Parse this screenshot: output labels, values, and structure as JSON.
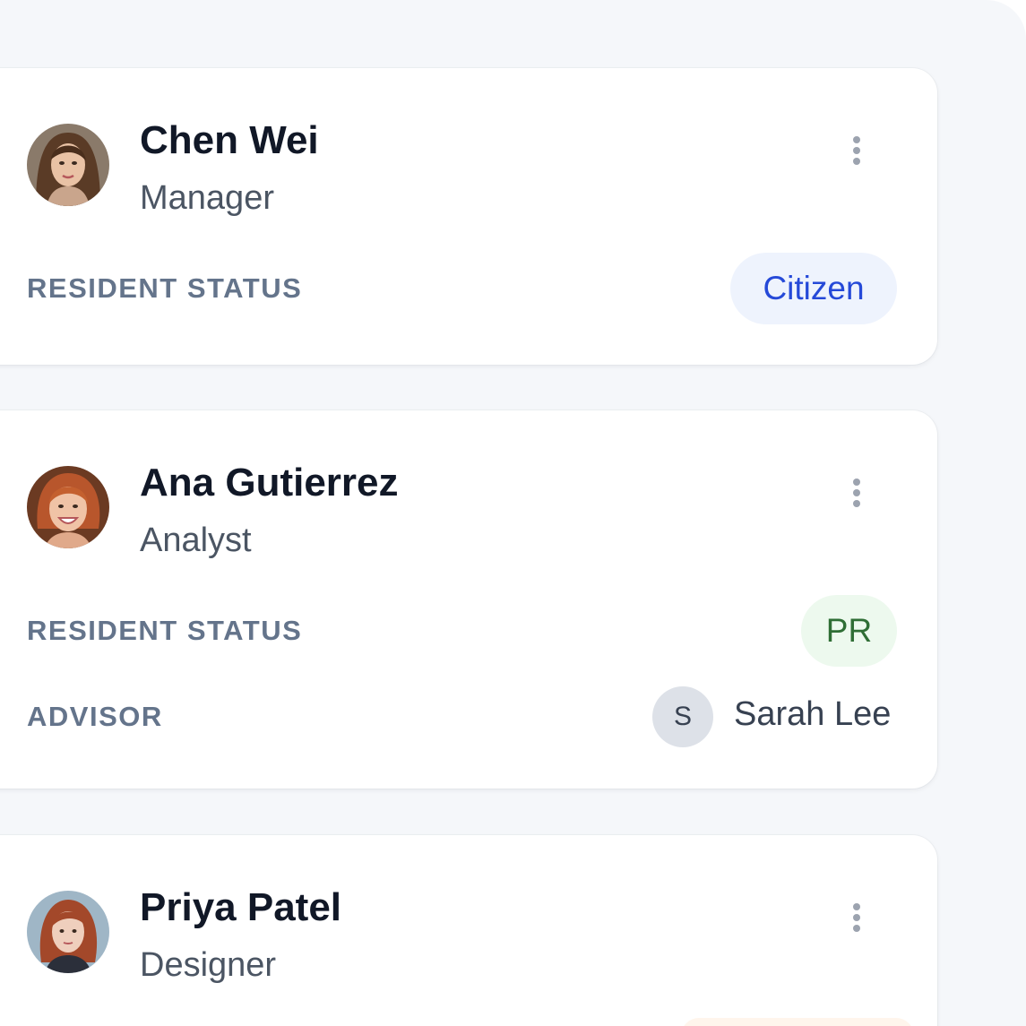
{
  "contacts": [
    {
      "name": "Chen Wei",
      "role": "Manager",
      "avatar": "profile-photo",
      "resident_status_label": "RESIDENT STATUS",
      "resident_status": "Citizen",
      "status_color": "#2549d8"
    },
    {
      "name": "Ana Gutierrez",
      "role": "Analyst",
      "avatar": "profile-photo",
      "resident_status_label": "RESIDENT STATUS",
      "resident_status": "PR",
      "status_color": "#2f6e35",
      "advisor_label": "ADVISOR",
      "advisor_initial": "S",
      "advisor_name": "Sarah Lee"
    },
    {
      "name": "Priya Patel",
      "role": "Designer",
      "avatar": "profile-photo"
    }
  ],
  "icons": {
    "more_menu": "more-vertical-icon"
  }
}
